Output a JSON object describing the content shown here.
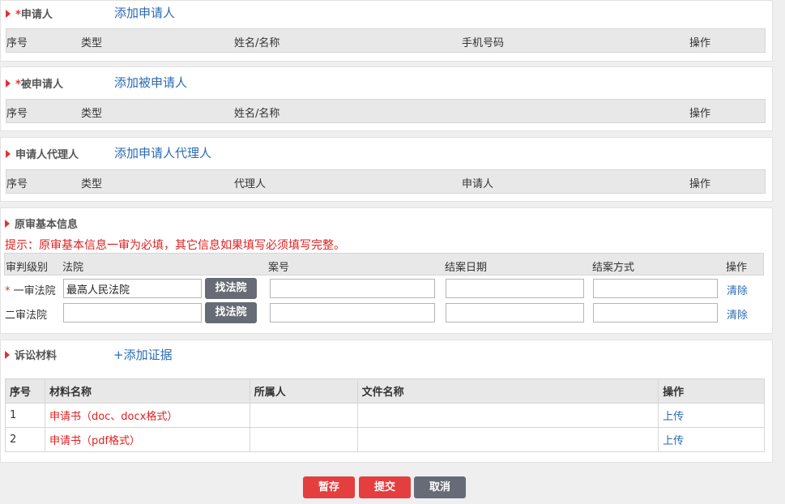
{
  "applicant": {
    "required_mark": "*",
    "title": "申请人",
    "add_link": "添加申请人",
    "columns": [
      "序号",
      "类型",
      "姓名/名称",
      "手机号码",
      "操作"
    ]
  },
  "respondent": {
    "required_mark": "*",
    "title": "被申请人",
    "add_link": "添加被申请人",
    "columns": [
      "序号",
      "类型",
      "姓名/名称",
      "操作"
    ]
  },
  "agent": {
    "title": "申请人代理人",
    "add_link": "添加申请人代理人",
    "columns": [
      "序号",
      "类型",
      "代理人",
      "申请人",
      "操作"
    ]
  },
  "original_trial": {
    "title": "原审基本信息",
    "tip": "提示：原审基本信息一审为必填，其它信息如果填写必须填写完整。",
    "columns": [
      "审判级别",
      "法院",
      "案号",
      "结案日期",
      "结案方式",
      "操作"
    ],
    "rows": [
      {
        "required_mark": "*",
        "level": "一审法院",
        "court_value": "最高人民法院",
        "find_label": "找法院",
        "clear_label": "清除"
      },
      {
        "required_mark": "",
        "level": "二审法院",
        "court_value": "",
        "find_label": "找法院",
        "clear_label": "清除"
      }
    ]
  },
  "materials": {
    "title": "诉讼材料",
    "add_link": "+添加证据",
    "columns": [
      "序号",
      "材料名称",
      "所属人",
      "文件名称",
      "操作"
    ],
    "rows": [
      {
        "no": "1",
        "name": "申请书（doc、docx格式）",
        "owner": "",
        "file": "",
        "action": "上传"
      },
      {
        "no": "2",
        "name": "申请书（pdf格式）",
        "owner": "",
        "file": "",
        "action": "上传"
      }
    ]
  },
  "footer": {
    "save_label": "暂存",
    "submit_label": "提交",
    "cancel_label": "取消"
  },
  "colors": {
    "accent_red": "#e53e3e",
    "link_blue": "#2a6ab3",
    "btn_gray": "#666b75"
  }
}
